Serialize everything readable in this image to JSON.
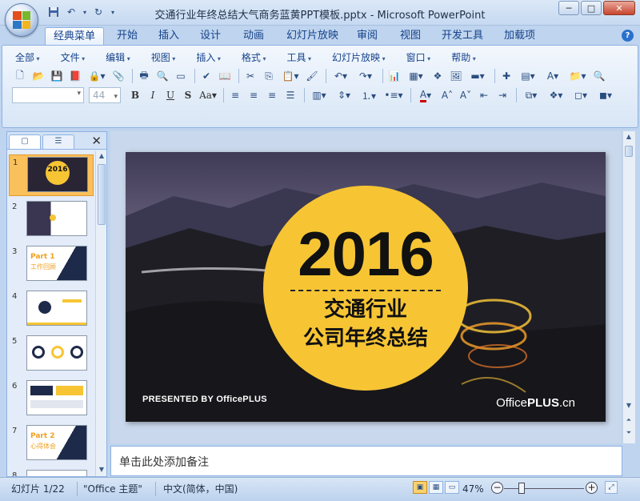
{
  "window": {
    "title": "交通行业年终总结大气商务蓝黄PPT模板.pptx - Microsoft PowerPoint",
    "controls": {
      "minimize": "─",
      "maximize": "□",
      "close": "✕"
    }
  },
  "quick_access": {
    "save_icon": "save-icon",
    "undo_icon": "undo-icon",
    "redo_icon": "redo-icon"
  },
  "ribbon_tabs": [
    "经典菜单",
    "开始",
    "插入",
    "设计",
    "动画",
    "幻灯片放映",
    "审阅",
    "视图",
    "开发工具",
    "加载项"
  ],
  "active_tab": "经典菜单",
  "classic_menus": [
    "全部",
    "文件",
    "编辑",
    "视图",
    "插入",
    "格式",
    "工具",
    "幻灯片放映",
    "窗口",
    "帮助"
  ],
  "font_size": "44",
  "thumbnail_count": 8,
  "slide": {
    "year": "2016",
    "line1": "交通行业",
    "line2": "公司年终总结",
    "presented": "PRESENTED BY OfficePLUS",
    "brand_prefix": "Office",
    "brand_bold": "PLUS",
    "brand_suffix": ".cn"
  },
  "thumbnails": [
    {
      "num": "1",
      "label": "2016"
    },
    {
      "num": "2",
      "label": ""
    },
    {
      "num": "3",
      "label": "Part 1",
      "sub": "工作回顾"
    },
    {
      "num": "4",
      "label": ""
    },
    {
      "num": "5",
      "label": ""
    },
    {
      "num": "6",
      "label": ""
    },
    {
      "num": "7",
      "label": "Part 2",
      "sub": "心得体会"
    },
    {
      "num": "8",
      "label": ""
    }
  ],
  "notes_placeholder": "单击此处添加备注",
  "status": {
    "slide_info": "幻灯片 1/22",
    "theme": "\"Office 主题\"",
    "language": "中文(简体，中国)",
    "zoom": "47%"
  },
  "colors": {
    "accent_yellow": "#f7c534",
    "ribbon_blue": "#bfd4ee"
  }
}
